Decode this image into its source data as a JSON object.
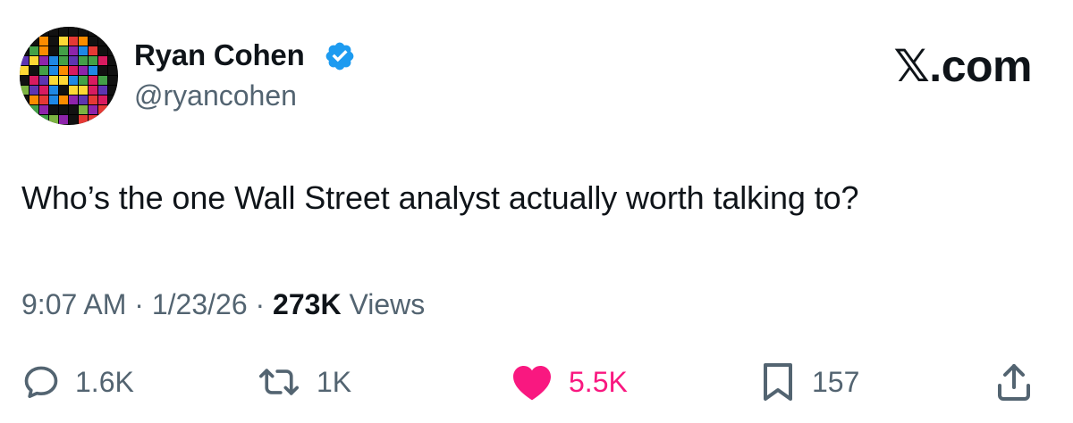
{
  "post": {
    "author": {
      "display_name": "Ryan Cohen",
      "handle": "@ryancohen",
      "verified": true,
      "avatar_icon": "pixel-tetris-avatar"
    },
    "brand": "𝕏.com",
    "text": "Who’s the one Wall Street analyst actually worth talking to?",
    "time": "9:07 AM",
    "date": "1/23/26",
    "separator": "·",
    "views_count": "273K",
    "views_label": "Views"
  },
  "actions": {
    "reply": {
      "icon": "reply-icon",
      "count": "1.6K"
    },
    "repost": {
      "icon": "repost-icon",
      "count": "1K"
    },
    "like": {
      "icon": "heart-icon",
      "count": "5.5K",
      "liked": true,
      "color": "#f91880"
    },
    "bookmark": {
      "icon": "bookmark-icon",
      "count": "157"
    },
    "share": {
      "icon": "share-icon"
    }
  },
  "colors": {
    "text": "#0f1419",
    "secondary": "#536471",
    "verified": "#1d9bf0",
    "like": "#f91880"
  }
}
